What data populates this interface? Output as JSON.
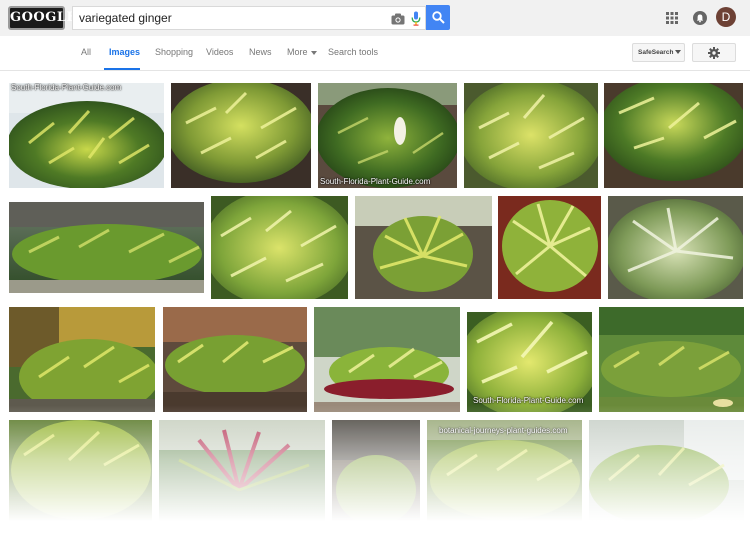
{
  "header": {
    "logo_text": "GOOGLE",
    "search_value": "variegated ginger",
    "search_button_icon": "search-icon",
    "camera_icon": "camera-icon",
    "mic_icon": "mic-icon",
    "apps_icon": "apps-grid-icon",
    "notifications_icon": "notifications-icon",
    "avatar_initial": "D",
    "accent_color": "#4285f4"
  },
  "nav": {
    "tabs": [
      {
        "label": "All",
        "active": false
      },
      {
        "label": "Images",
        "active": true
      },
      {
        "label": "Shopping",
        "active": false
      },
      {
        "label": "Videos",
        "active": false
      },
      {
        "label": "News",
        "active": false
      },
      {
        "label": "More",
        "active": false
      },
      {
        "label": "Search tools",
        "active": false
      }
    ],
    "safesearch_label": "SafeSearch",
    "settings_icon": "gear-icon"
  },
  "results": {
    "captions": [
      "South-Florida-Plant-Guide.com",
      "South-Florida-Plant-Guide.com",
      "South-Florida-Plant-Guide.com",
      "botanical-journeys-plant-guides.com"
    ]
  }
}
